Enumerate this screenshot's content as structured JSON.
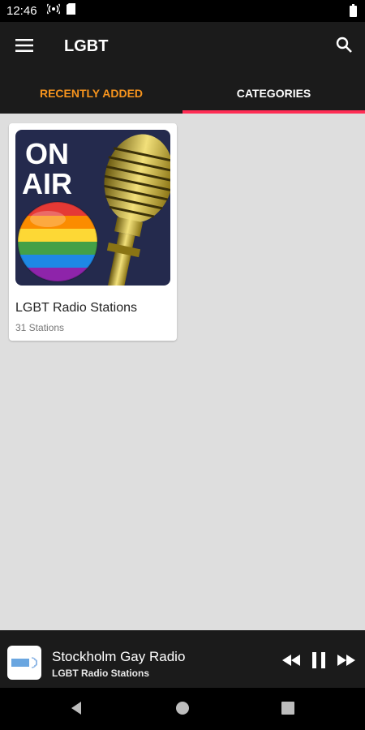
{
  "status_bar": {
    "time": "12:46",
    "icons": [
      "radio-signal-icon",
      "sim-card-icon",
      "battery-icon"
    ]
  },
  "app_bar": {
    "title": "LGBT",
    "icons": [
      "menu-icon",
      "search-icon"
    ]
  },
  "tabs": [
    {
      "label": "RECENTLY ADDED",
      "active": false
    },
    {
      "label": "CATEGORIES",
      "active": true
    }
  ],
  "category": {
    "title": "LGBT Radio Stations",
    "subtitle": "31 Stations",
    "art_text": [
      "ON",
      "AIR"
    ]
  },
  "player": {
    "station": "Stockholm Gay Radio",
    "category": "LGBT Radio Stations",
    "controls": [
      "rewind-icon",
      "pause-icon",
      "fast-forward-icon"
    ]
  },
  "colors": {
    "accent_orange": "#f7941d",
    "tab_indicator": "#ff2d55",
    "bar_bg": "#1b1b1b",
    "content_bg": "#dedede"
  }
}
